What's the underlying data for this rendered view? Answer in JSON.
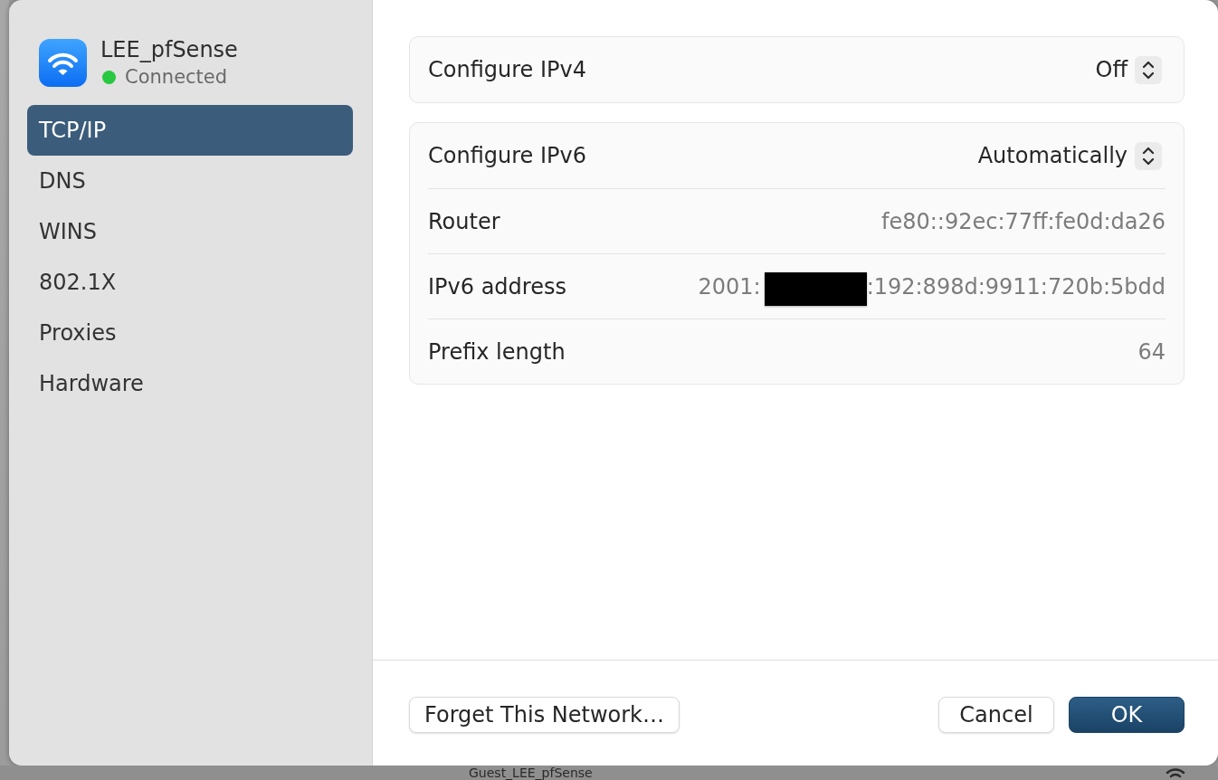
{
  "network": {
    "name": "LEE_pfSense",
    "status": "Connected",
    "connected": true
  },
  "sidebar": {
    "items": [
      {
        "label": "TCP/IP",
        "selected": true
      },
      {
        "label": "DNS",
        "selected": false
      },
      {
        "label": "WINS",
        "selected": false
      },
      {
        "label": "802.1X",
        "selected": false
      },
      {
        "label": "Proxies",
        "selected": false
      },
      {
        "label": "Hardware",
        "selected": false
      }
    ]
  },
  "cards": [
    {
      "rows": [
        {
          "kind": "popup",
          "label": "Configure IPv4",
          "value": "Off"
        }
      ]
    },
    {
      "rows": [
        {
          "kind": "popup",
          "label": "Configure IPv6",
          "value": "Automatically"
        },
        {
          "kind": "value",
          "label": "Router",
          "value": "fe80::92ec:77ff:fe0d:da26"
        },
        {
          "kind": "redacted",
          "label": "IPv6 address",
          "value_start": "2001:",
          "value_end": ":192:898d:9911:720b:5bdd"
        },
        {
          "kind": "value",
          "label": "Prefix length",
          "value": "64"
        }
      ]
    }
  ],
  "footer": {
    "left_button": "Forget This Network…",
    "buttons": [
      {
        "label": "Cancel",
        "kind": "secondary"
      },
      {
        "label": "OK",
        "kind": "default"
      }
    ]
  },
  "background": {
    "row_label": "Guest_LEE_pfSense"
  }
}
